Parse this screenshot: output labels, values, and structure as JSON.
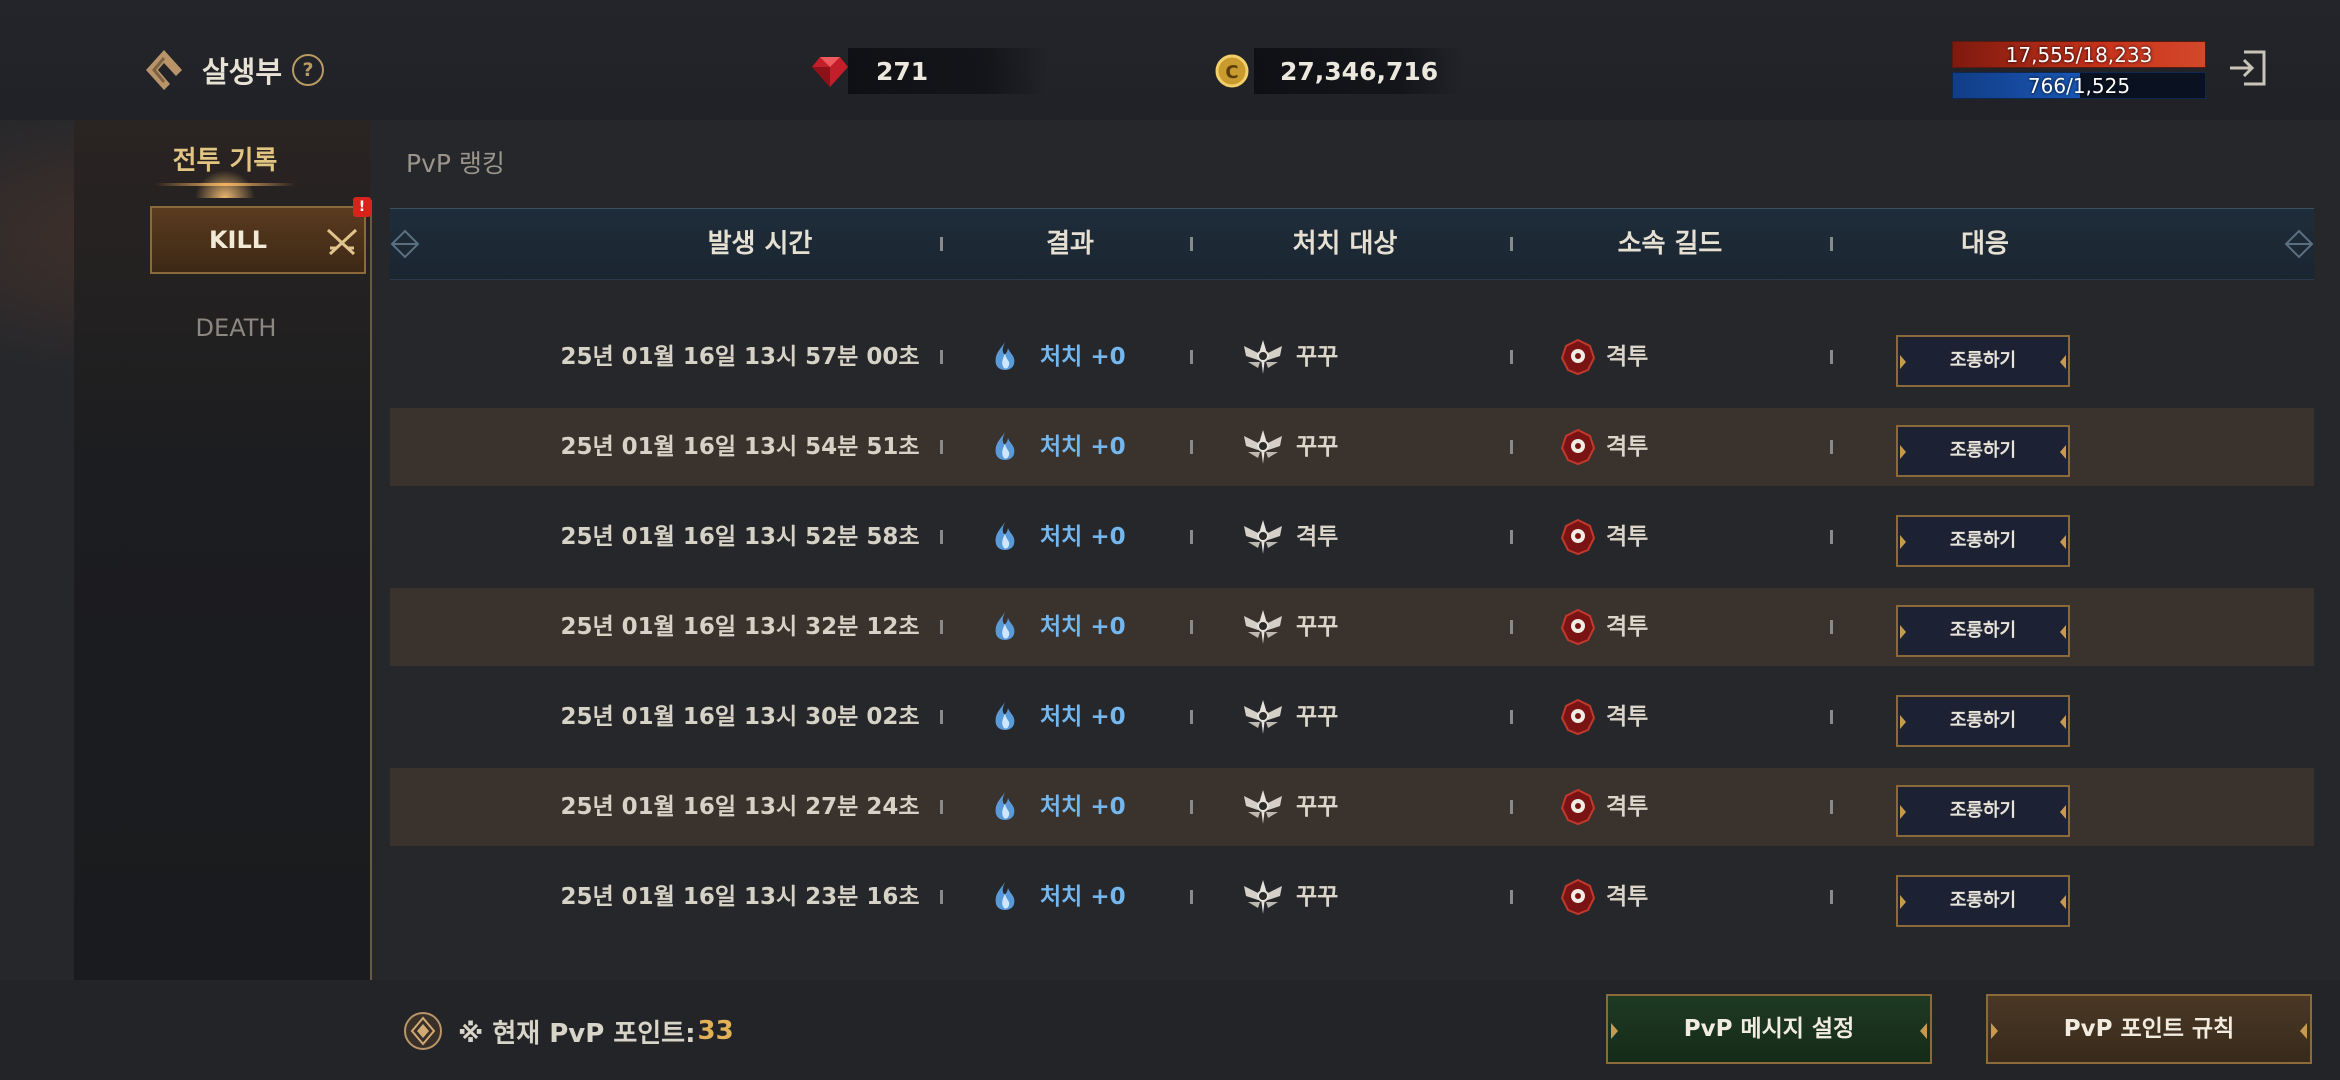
{
  "header": {
    "title": "살생부",
    "help_label": "?",
    "gem_value": "271",
    "gold_value": "27,346,716",
    "hp_text": "17,555/18,233",
    "mp_text": "766/1,525",
    "hp_fraction": 0.963,
    "mp_fraction": 0.502
  },
  "tabs": [
    {
      "label": "전투 기록",
      "active": true
    },
    {
      "label": "PvP 랭킹",
      "active": false
    }
  ],
  "sidebar": {
    "items": [
      {
        "label": "KILL",
        "active": true,
        "badge": "!"
      },
      {
        "label": "DEATH",
        "active": false
      }
    ]
  },
  "table": {
    "columns": [
      "발생 시간",
      "결과",
      "처치 대상",
      "소속 길드",
      "대응"
    ],
    "rows": [
      {
        "time": "25년 01월 16일 13시 57분 00초",
        "result": "처치 +0",
        "target": "꾸꾸",
        "guild": "격투",
        "action": "조롱하기"
      },
      {
        "time": "25년 01월 16일 13시 54분 51초",
        "result": "처치 +0",
        "target": "꾸꾸",
        "guild": "격투",
        "action": "조롱하기"
      },
      {
        "time": "25년 01월 16일 13시 52분 58초",
        "result": "처치 +0",
        "target": "격투",
        "guild": "격투",
        "action": "조롱하기"
      },
      {
        "time": "25년 01월 16일 13시 32분 12초",
        "result": "처치 +0",
        "target": "꾸꾸",
        "guild": "격투",
        "action": "조롱하기"
      },
      {
        "time": "25년 01월 16일 13시 30분 02초",
        "result": "처치 +0",
        "target": "꾸꾸",
        "guild": "격투",
        "action": "조롱하기"
      },
      {
        "time": "25년 01월 16일 13시 27분 24초",
        "result": "처치 +0",
        "target": "꾸꾸",
        "guild": "격투",
        "action": "조롱하기"
      },
      {
        "time": "25년 01월 16일 13시 23분 16초",
        "result": "처치 +0",
        "target": "꾸꾸",
        "guild": "격투",
        "action": "조롱하기"
      }
    ]
  },
  "footer": {
    "pvp_points_label": "※ 현재 PvP 포인트:",
    "pvp_points_value": "33",
    "message_button": "PvP 메시지 설정",
    "rules_button": "PvP 포인트 규칙"
  },
  "colors": {
    "accent_gold": "#e2c583",
    "result_blue": "#74b6ee",
    "row_light": "#3a332d",
    "row_dark": "#26272b",
    "hp_red": "#c8331b",
    "mp_blue": "#1b5bbd"
  },
  "icons": {
    "title": "kill-list-emblem-icon",
    "gem": "red-gem-icon",
    "gold": "gold-coin-icon",
    "exit": "exit-icon",
    "result": "blue-flame-icon",
    "target": "winged-crest-icon",
    "guild": "guild-emblem-icon",
    "points": "pvp-point-icon",
    "kill_tab": "crossed-swords-icon"
  }
}
